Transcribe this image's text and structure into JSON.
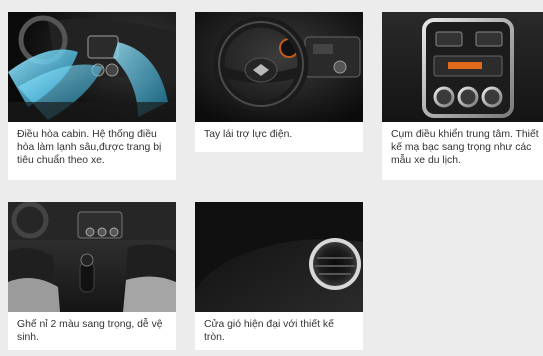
{
  "gallery": {
    "items": [
      {
        "image": "car-interior-air-conditioning-photo",
        "caption": "Điều hòa cabin. Hệ thống điều hòa làm lạnh sâu,được trang bị tiêu chuẩn theo xe."
      },
      {
        "image": "steering-wheel-photo",
        "caption": "Tay lái trợ lực điện."
      },
      {
        "image": "center-console-photo",
        "caption": "Cụm điều khiển trung tâm. Thiết kế mạ bạc sang trọng như các mẫu xe du lịch."
      },
      {
        "image": "two-tone-seats-photo",
        "caption": "Ghế nỉ 2 màu sang trọng, dễ vệ sinh."
      },
      {
        "image": "air-vent-photo",
        "caption": "Cửa gió hiện đại với thiết kế tròn."
      }
    ]
  }
}
